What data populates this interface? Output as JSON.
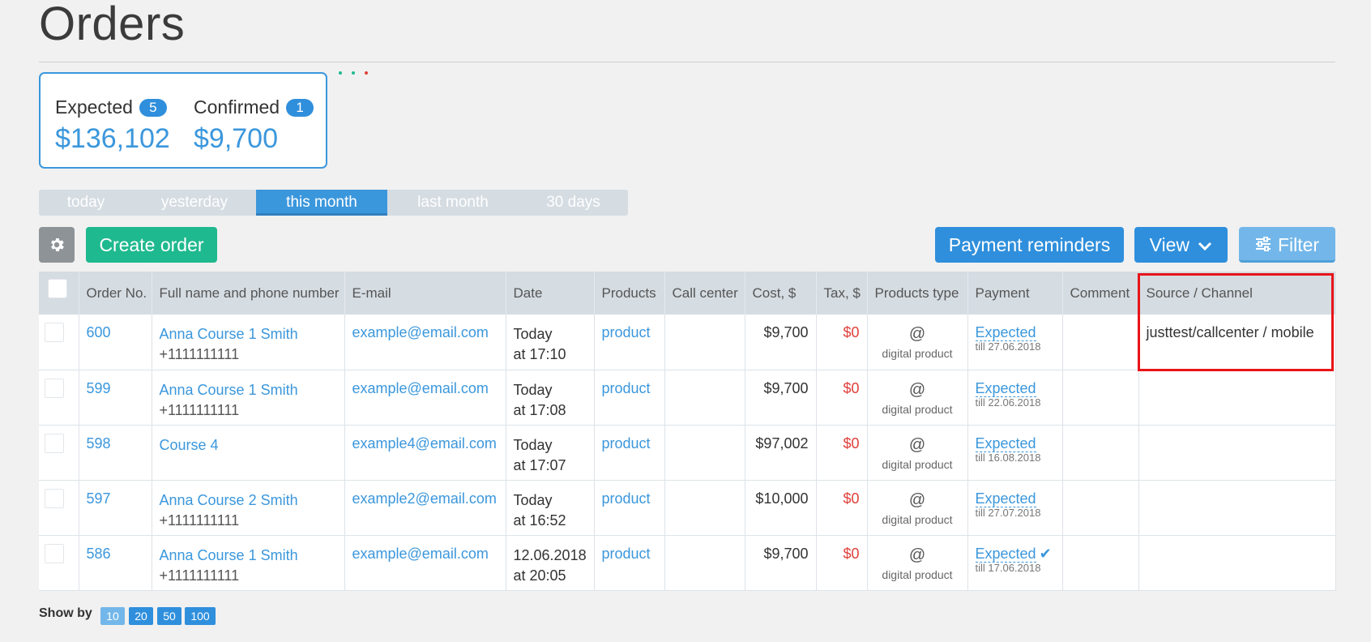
{
  "page": {
    "title": "Orders"
  },
  "summary": {
    "expected": {
      "label": "Expected",
      "count": "5",
      "amount": "$136,102"
    },
    "confirmed": {
      "label": "Confirmed",
      "count": "1",
      "amount": "$9,700"
    }
  },
  "dots_colors": [
    "#1fb98f",
    "#1fb98f",
    "#e0403a"
  ],
  "period_tabs": [
    {
      "label": "today",
      "active": false
    },
    {
      "label": "yesterday",
      "active": false
    },
    {
      "label": "this month",
      "active": true
    },
    {
      "label": "last month",
      "active": false
    },
    {
      "label": "30 days",
      "active": false
    }
  ],
  "toolbar": {
    "settings_icon": "gear-icon",
    "create_label": "Create order",
    "reminders_label": "Payment reminders",
    "view_label": "View",
    "filter_label": "Filter"
  },
  "table": {
    "columns": [
      "Order No.",
      "Full name and phone number",
      "E-mail",
      "Date",
      "Products",
      "Call center",
      "Cost, $",
      "Tax, $",
      "Products type",
      "Payment",
      "Comment",
      "Source / Channel"
    ],
    "rows": [
      {
        "order": "600",
        "name": "Anna Course 1 Smith",
        "phone": "+1111111111",
        "email": "example@email.com",
        "date_day": "Today",
        "date_time": "at 17:10",
        "product": "product",
        "call_center": "",
        "cost": "$9,700",
        "tax": "$0",
        "ptype_icon": "@",
        "ptype": "digital product",
        "payment": "Expected",
        "till": "till 27.06.2018",
        "confirmed": false,
        "comment": "",
        "source": "justtest/callcenter / mobile"
      },
      {
        "order": "599",
        "name": "Anna Course 1 Smith",
        "phone": "+1111111111",
        "email": "example@email.com",
        "date_day": "Today",
        "date_time": "at 17:08",
        "product": "product",
        "call_center": "",
        "cost": "$9,700",
        "tax": "$0",
        "ptype_icon": "@",
        "ptype": "digital product",
        "payment": "Expected",
        "till": "till 22.06.2018",
        "confirmed": false,
        "comment": "",
        "source": ""
      },
      {
        "order": "598",
        "name": "Course 4",
        "phone": "",
        "email": "example4@email.com",
        "date_day": "Today",
        "date_time": "at 17:07",
        "product": "product",
        "call_center": "",
        "cost": "$97,002",
        "tax": "$0",
        "ptype_icon": "@",
        "ptype": "digital product",
        "payment": "Expected",
        "till": "till 16.08.2018",
        "confirmed": false,
        "comment": "",
        "source": ""
      },
      {
        "order": "597",
        "name": "Anna Course 2 Smith",
        "phone": "+1111111111",
        "email": "example2@email.com",
        "date_day": "Today",
        "date_time": "at 16:52",
        "product": "product",
        "call_center": "",
        "cost": "$10,000",
        "tax": "$0",
        "ptype_icon": "@",
        "ptype": "digital product",
        "payment": "Expected",
        "till": "till 27.07.2018",
        "confirmed": false,
        "comment": "",
        "source": ""
      },
      {
        "order": "586",
        "name": "Anna Course 1 Smith",
        "phone": "+1111111111",
        "email": "example@email.com",
        "date_day": "12.06.2018",
        "date_time": "at 20:05",
        "product": "product",
        "call_center": "",
        "cost": "$9,700",
        "tax": "$0",
        "ptype_icon": "@",
        "ptype": "digital product",
        "payment": "Expected",
        "till": "till 17.06.2018",
        "confirmed": true,
        "comment": "",
        "source": ""
      }
    ]
  },
  "pagination": {
    "label": "Show by",
    "sizes": [
      {
        "label": "10",
        "active": true
      },
      {
        "label": "20",
        "active": false
      },
      {
        "label": "50",
        "active": false
      },
      {
        "label": "100",
        "active": false
      }
    ]
  }
}
